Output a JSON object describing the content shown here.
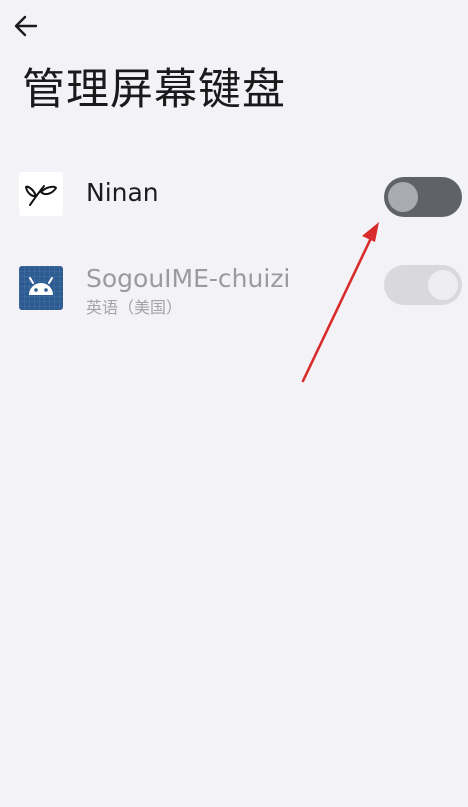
{
  "header": {
    "title": "管理屏幕键盘"
  },
  "keyboards": [
    {
      "name": "Ninan",
      "subtitle": "",
      "enabled": false,
      "toggle_state": "off"
    },
    {
      "name": "SogouIME-chuizi",
      "subtitle": "英语（美国）",
      "enabled": true,
      "toggle_state": "on-disabled"
    }
  ],
  "icons": {
    "back": "back-arrow-icon",
    "ninan": "ninan-sprout-icon",
    "sogou": "android-robot-icon"
  },
  "colors": {
    "background": "#f3f2f7",
    "toggle_off_track": "#5f6368",
    "toggle_disabled_track": "#d9d9dd",
    "annotation_arrow": "#d92b2b",
    "sogou_icon_bg": "#2e5b8f"
  }
}
